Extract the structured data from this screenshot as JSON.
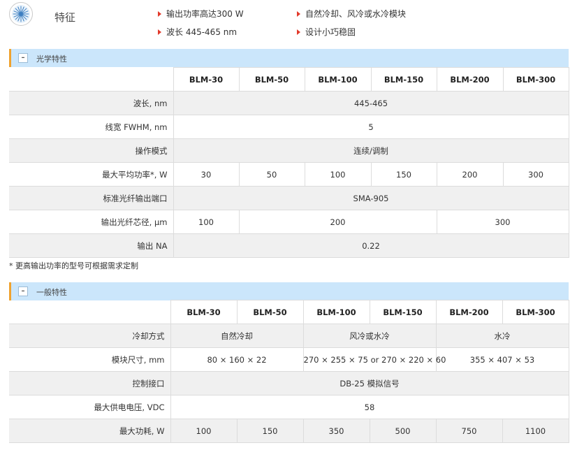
{
  "features": {
    "title": "特征",
    "items": [
      "输出功率高达300 W",
      "自然冷却、风冷或水冷模块",
      "波长 445-465 nm",
      "设计小巧稳固"
    ]
  },
  "optical": {
    "toggle": "–",
    "title": "光学特性",
    "models": [
      "BLM-30",
      "BLM-50",
      "BLM-100",
      "BLM-150",
      "BLM-200",
      "BLM-300"
    ],
    "rows": {
      "wavelength": {
        "label": "波长, nm",
        "value": "445-465"
      },
      "linewidth": {
        "label": "线宽 FWHM, nm",
        "value": "5"
      },
      "mode": {
        "label": "操作模式",
        "value": "连续/调制"
      },
      "power": {
        "label": "最大平均功率*, W",
        "values": [
          "30",
          "50",
          "100",
          "150",
          "200",
          "300"
        ]
      },
      "port": {
        "label": "标准光纤输出端口",
        "value": "SMA-905"
      },
      "core": {
        "label": "输出光纤芯径, μm",
        "values": [
          "100",
          "200",
          "300"
        ]
      },
      "na": {
        "label": "输出 NA",
        "value": "0.22"
      }
    },
    "note": "* 更高输出功率的型号可根据需求定制"
  },
  "general": {
    "toggle": "–",
    "title": "一般特性",
    "models": [
      "BLM-30",
      "BLM-50",
      "BLM-100",
      "BLM-150",
      "BLM-200",
      "BLM-300"
    ],
    "rows": {
      "cooling": {
        "label": "冷却方式",
        "values": [
          "自然冷却",
          "风冷或水冷",
          "水冷"
        ]
      },
      "size": {
        "label": "模块尺寸, mm",
        "values": [
          "80 × 160 × 22",
          "270 × 255 × 75 or 270 × 220 × 60",
          "355 × 407 × 53"
        ]
      },
      "control": {
        "label": "控制接口",
        "value": "DB-25 模拟信号"
      },
      "voltage": {
        "label": "最大供电电压, VDC",
        "value": "58"
      },
      "consumption": {
        "label": "最大功耗, W",
        "values": [
          "100",
          "150",
          "350",
          "500",
          "750",
          "1100"
        ]
      }
    }
  },
  "colors": {
    "bullet": "#e23a2b",
    "section_bar": "#cbe6fb",
    "section_accent": "#f0a22e",
    "icon_blue": "#3d7fc1"
  },
  "icons": {
    "feature": "laser-burst-icon",
    "bullet": "red-triangle-icon",
    "toggle": "collapse-minus-icon"
  }
}
